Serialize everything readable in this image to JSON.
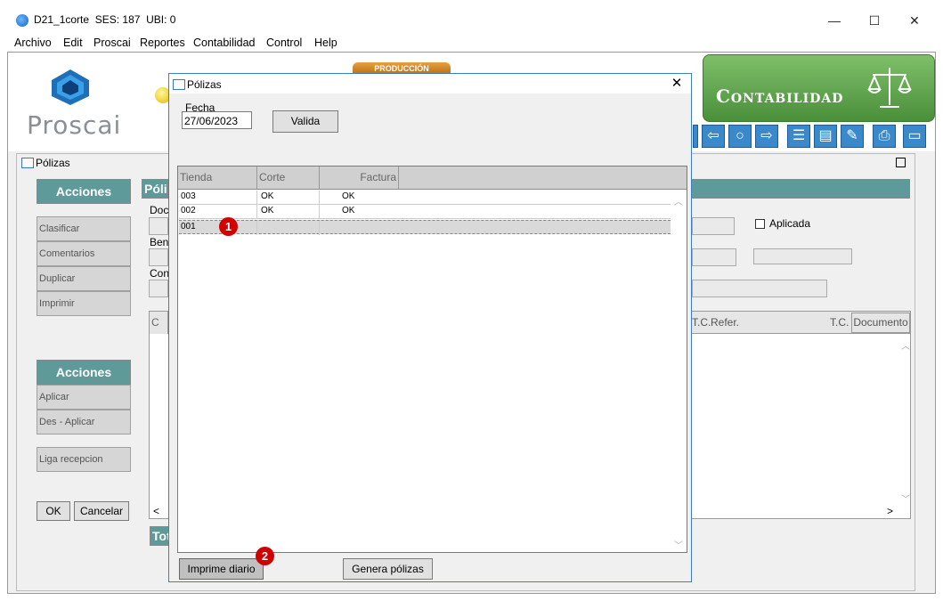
{
  "window": {
    "title": "D21_1corte",
    "ses": "SES: 187",
    "ubi": "UBI: 0",
    "minimize": "—",
    "maximize": "☐",
    "close": "✕"
  },
  "menu": [
    "Archivo",
    "Edit",
    "Proscai",
    "Reportes",
    "Contabilidad",
    "Control",
    "Help"
  ],
  "header": {
    "logo_text": "Proscai",
    "production_badge": "PRODUCCIÓN",
    "module_title": "Contabilidad"
  },
  "toolbar": {
    "icons": [
      "back-arrow-icon",
      "search-user-icon",
      "forward-arrow-icon",
      "list-icon",
      "edit-list-icon",
      "edit-icon",
      "print-icon",
      "window-icon"
    ]
  },
  "polizas_window": {
    "title": "Pólizas",
    "section_title_partial": "Póli",
    "acciones_label": "Acciones",
    "actions_top": [
      "Clasificar",
      "Comentarios",
      "Duplicar",
      "Imprimir"
    ],
    "actions_bottom": [
      "Aplicar",
      "Des - Aplicar"
    ],
    "liga_recepcion": "Liga recepcion",
    "ok": "OK",
    "cancel": "Cancelar",
    "label_doc": "Doc",
    "label_ben": "Ben",
    "label_con": "Con",
    "aplicada": "Aplicada",
    "totals_partial": "Tot",
    "col_c": "C",
    "col_tc1": "T.C.",
    "col_refer": "Refer.",
    "col_tc2": "T.C.",
    "col_documento": "Documento"
  },
  "dialog": {
    "title": "Pólizas",
    "fecha_label": "Fecha",
    "fecha_value": "27/06/2023",
    "valida_button": "Valida",
    "columns": [
      "Tienda",
      "Corte",
      "Factura"
    ],
    "rows": [
      {
        "tienda": "003",
        "corte": "OK",
        "factura": "OK"
      },
      {
        "tienda": "002",
        "corte": "OK",
        "factura": "OK"
      },
      {
        "tienda": "001",
        "corte": "",
        "factura": ""
      }
    ],
    "imprime_button": "Imprime diario",
    "genera_button": "Genera pólizas",
    "badge1": "1",
    "badge2": "2"
  }
}
